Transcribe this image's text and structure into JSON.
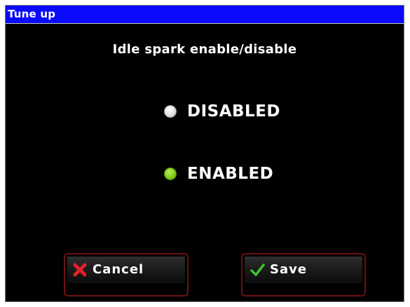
{
  "window": {
    "title": "Tune up"
  },
  "dialog": {
    "heading": "Idle spark enable/disable",
    "options": [
      {
        "label": "DISABLED",
        "selected": false,
        "dot_color": "#e0e0e0"
      },
      {
        "label": "ENABLED",
        "selected": true,
        "dot_color": "#86cc1a"
      }
    ],
    "buttons": {
      "cancel": {
        "label": "Cancel",
        "icon": "x-icon",
        "icon_color": "#e0202a"
      },
      "save": {
        "label": "Save",
        "icon": "checkmark-icon",
        "icon_color": "#3fbf2f"
      }
    }
  },
  "colors": {
    "titlebar": "#0a0aff",
    "background": "#000000",
    "button_border": "#6e1010"
  }
}
